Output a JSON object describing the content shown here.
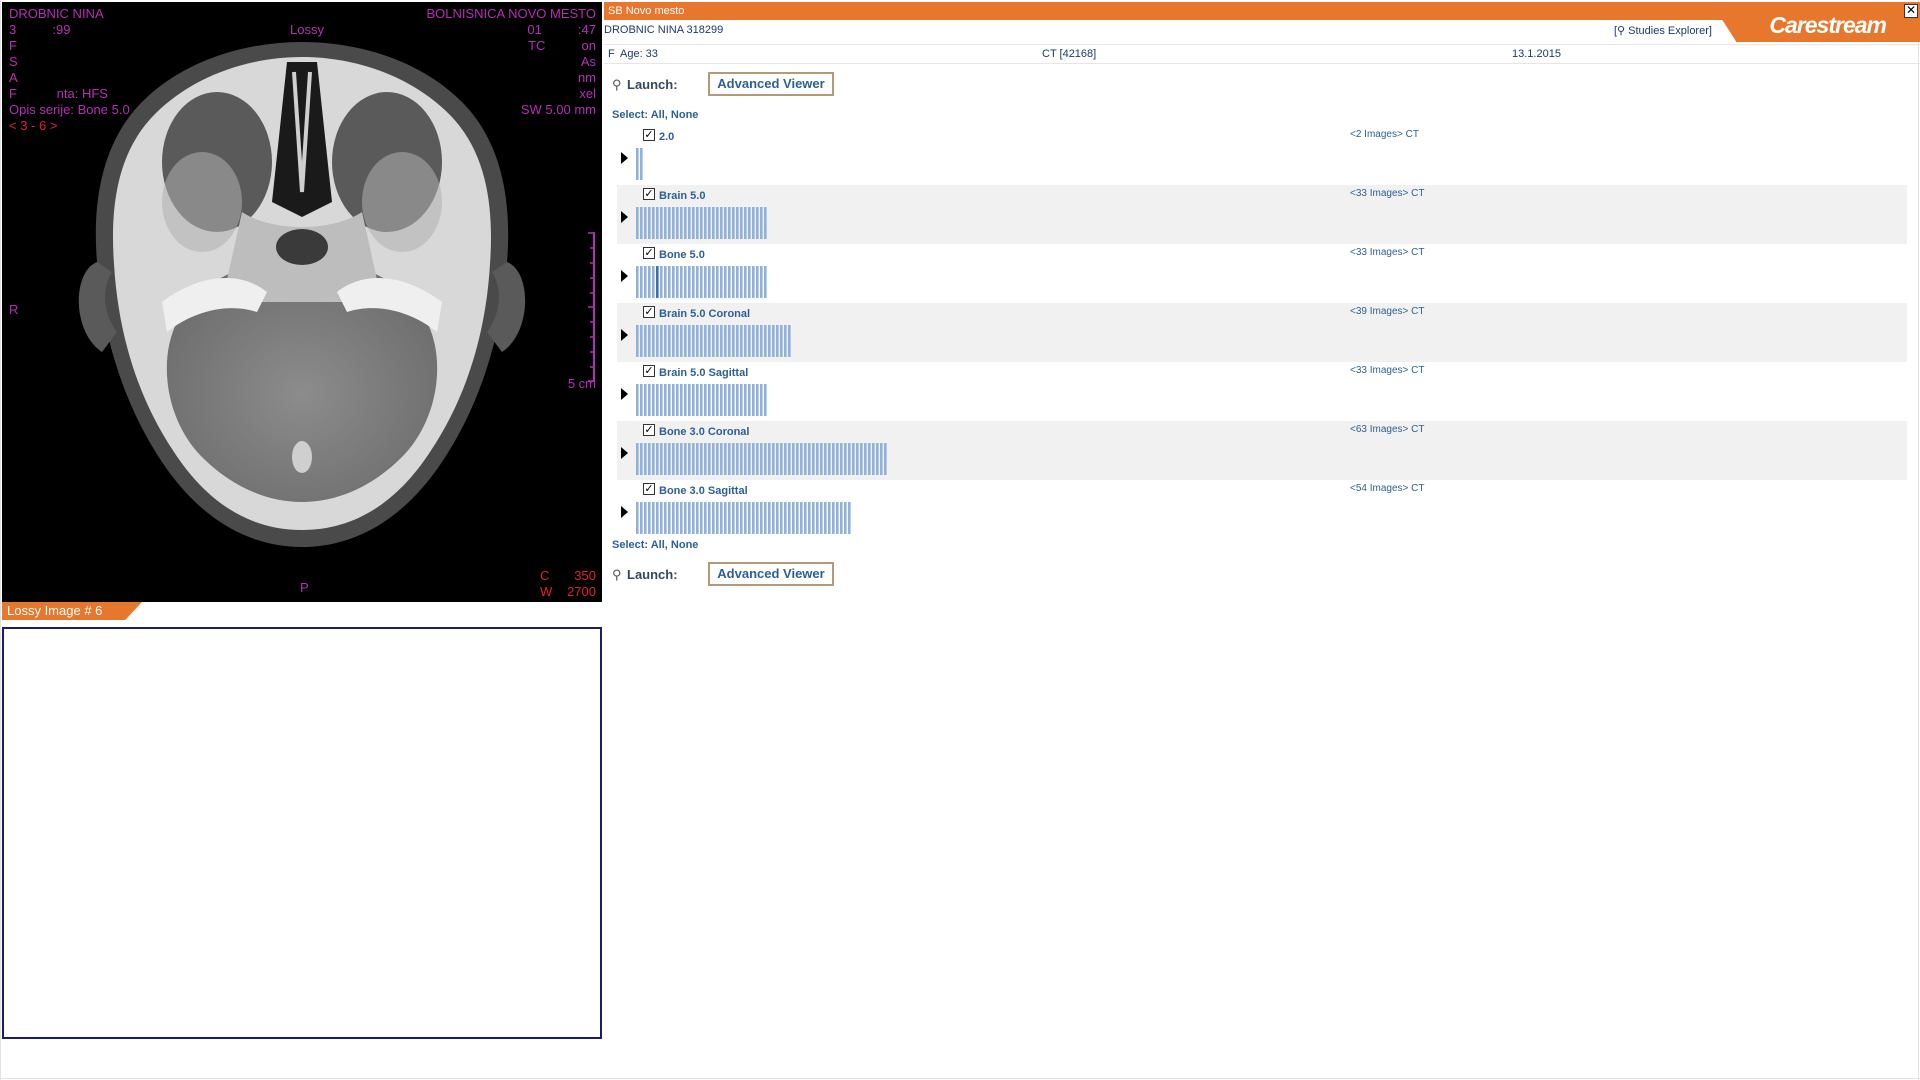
{
  "viewer": {
    "overlay": {
      "patient_name": "DROBNIC NINA",
      "hospital": "BOLNISNICA NOVO MESTO",
      "line2_left": "3          :99",
      "lossy_label": "Lossy",
      "line2_right": "01          :47",
      "line3_left": "F",
      "line3_right": "TC          on",
      "line4_left": "S",
      "line4_right": "As",
      "line5_left": "A",
      "line5_right": "nm",
      "line6_left": "F           nta: HFS",
      "line6_right": "xel",
      "series_desc": "Opis serije: Bone 5.0",
      "slice_thickness": "SW 5.00 mm",
      "nav": "< 3 - 6 >",
      "orient_left": "R",
      "orient_bottom": "P",
      "scale_label": "5 cm",
      "c_label": "C",
      "c_value": "350",
      "w_label": "W",
      "w_value": "2700"
    },
    "lossy_tab": "Lossy Image # 6"
  },
  "explorer": {
    "site": "SB Novo mesto",
    "logo": "Carestream",
    "close_symbol": "✕",
    "patient": "DROBNIC NINA  318299",
    "studies_explorer": "[⚲ Studies Explorer]",
    "sex": "F",
    "age": "Age: 33",
    "study": "CT [42168]",
    "date": "13.1.2015",
    "launch_label": "Launch:",
    "key_symbol": "⚲",
    "advanced_viewer": "Advanced Viewer",
    "select_prefix": "Select:",
    "select_all": "All",
    "select_none": "None",
    "check_symbol": "✓",
    "series": [
      {
        "name": "2.0",
        "count": "<2 Images> CT",
        "images": 2
      },
      {
        "name": "Brain 5.0",
        "count": "<33 Images> CT",
        "images": 33
      },
      {
        "name": "Bone 5.0",
        "count": "<33 Images> CT",
        "images": 33,
        "active_index": 5
      },
      {
        "name": "Brain 5.0 Coronal",
        "count": "<39 Images> CT",
        "images": 39
      },
      {
        "name": "Brain 5.0 Sagittal",
        "count": "<33 Images> CT",
        "images": 33
      },
      {
        "name": "Bone 3.0 Coronal",
        "count": "<63 Images> CT",
        "images": 63
      },
      {
        "name": "Bone 3.0 Sagittal",
        "count": "<54 Images> CT",
        "images": 54
      }
    ]
  },
  "colors": {
    "accent_orange": "#e8772e",
    "overlay_magenta": "#b42fb4",
    "overlay_red": "#e0203a",
    "link_blue": "#2d5f95",
    "thumb_blue": "#8fb1dc",
    "thumb_active": "#3c6fb0"
  }
}
